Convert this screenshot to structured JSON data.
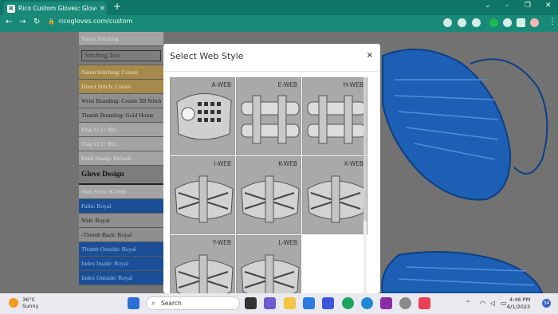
{
  "browser": {
    "tab_title": "Rico Custom Gloves: Glove Cust...",
    "tab_close": "✕",
    "favicon_text": "R",
    "new_tab": "+",
    "window_controls": [
      "⌄",
      "–",
      "❐",
      "✕"
    ],
    "url": "ricogloves.com/custom",
    "nav": {
      "back": "←",
      "forward": "→",
      "reload": "↻"
    },
    "menu": "⋮"
  },
  "left_panel": {
    "rows": [
      {
        "label": "Name Stitching",
        "style": "gray"
      },
      {
        "label": "Stitching Text",
        "style": "input"
      },
      {
        "label": "Name Stitching: Cream",
        "style": "tan"
      },
      {
        "label": "Direct Stitch: Cream",
        "style": "tan"
      },
      {
        "label": "Wrist Branding: Cream 3D Stitch",
        "style": "light"
      },
      {
        "label": "Thumb Branding: Gold Home",
        "style": "light"
      },
      {
        "label": "Flag #1 (+ $$)...",
        "style": "gray"
      },
      {
        "label": "Flag #2 (+ $$)...",
        "style": "gray"
      },
      {
        "label": "Palm Stamp: Default",
        "style": "gray"
      },
      {
        "label": "Glove Design",
        "style": "header"
      },
      {
        "label": "Web Style: K-Web",
        "style": "gray"
      },
      {
        "label": "Palm: Royal",
        "style": "blue"
      },
      {
        "label": "Web: Royal",
        "style": "light"
      },
      {
        "label": "-Thumb Back: Royal",
        "style": "light"
      },
      {
        "label": "Thumb Outside: Royal",
        "style": "blue"
      },
      {
        "label": "Index Inside: Royal",
        "style": "blue"
      },
      {
        "label": "Index Outside: Royal",
        "style": "blue"
      }
    ]
  },
  "modal": {
    "title": "Select Web Style",
    "close": "×",
    "webs": [
      {
        "label": "A-WEB",
        "icon": "a-web-icon"
      },
      {
        "label": "E-WEB",
        "icon": "e-web-icon"
      },
      {
        "label": "H-WEB",
        "icon": "h-web-icon"
      },
      {
        "label": "I-WEB",
        "icon": "i-web-icon"
      },
      {
        "label": "K-WEB",
        "icon": "k-web-icon"
      },
      {
        "label": "X-WEB",
        "icon": "x-web-icon"
      },
      {
        "label": "Y-WEB",
        "icon": "y-web-icon"
      },
      {
        "label": "L-WEB",
        "icon": "l-web-icon"
      }
    ]
  },
  "taskbar": {
    "weather_temp": "36°C",
    "weather_desc": "Sunny",
    "search_placeholder": "Search",
    "time": "4:46 PM",
    "date": "6/1/2023",
    "notification_count": "34"
  },
  "colors": {
    "chrome_teal": "#0f7566",
    "royal_blue": "#1a4e96",
    "glove_blue": "#1d5fb4",
    "cream": "#a58a4c"
  }
}
